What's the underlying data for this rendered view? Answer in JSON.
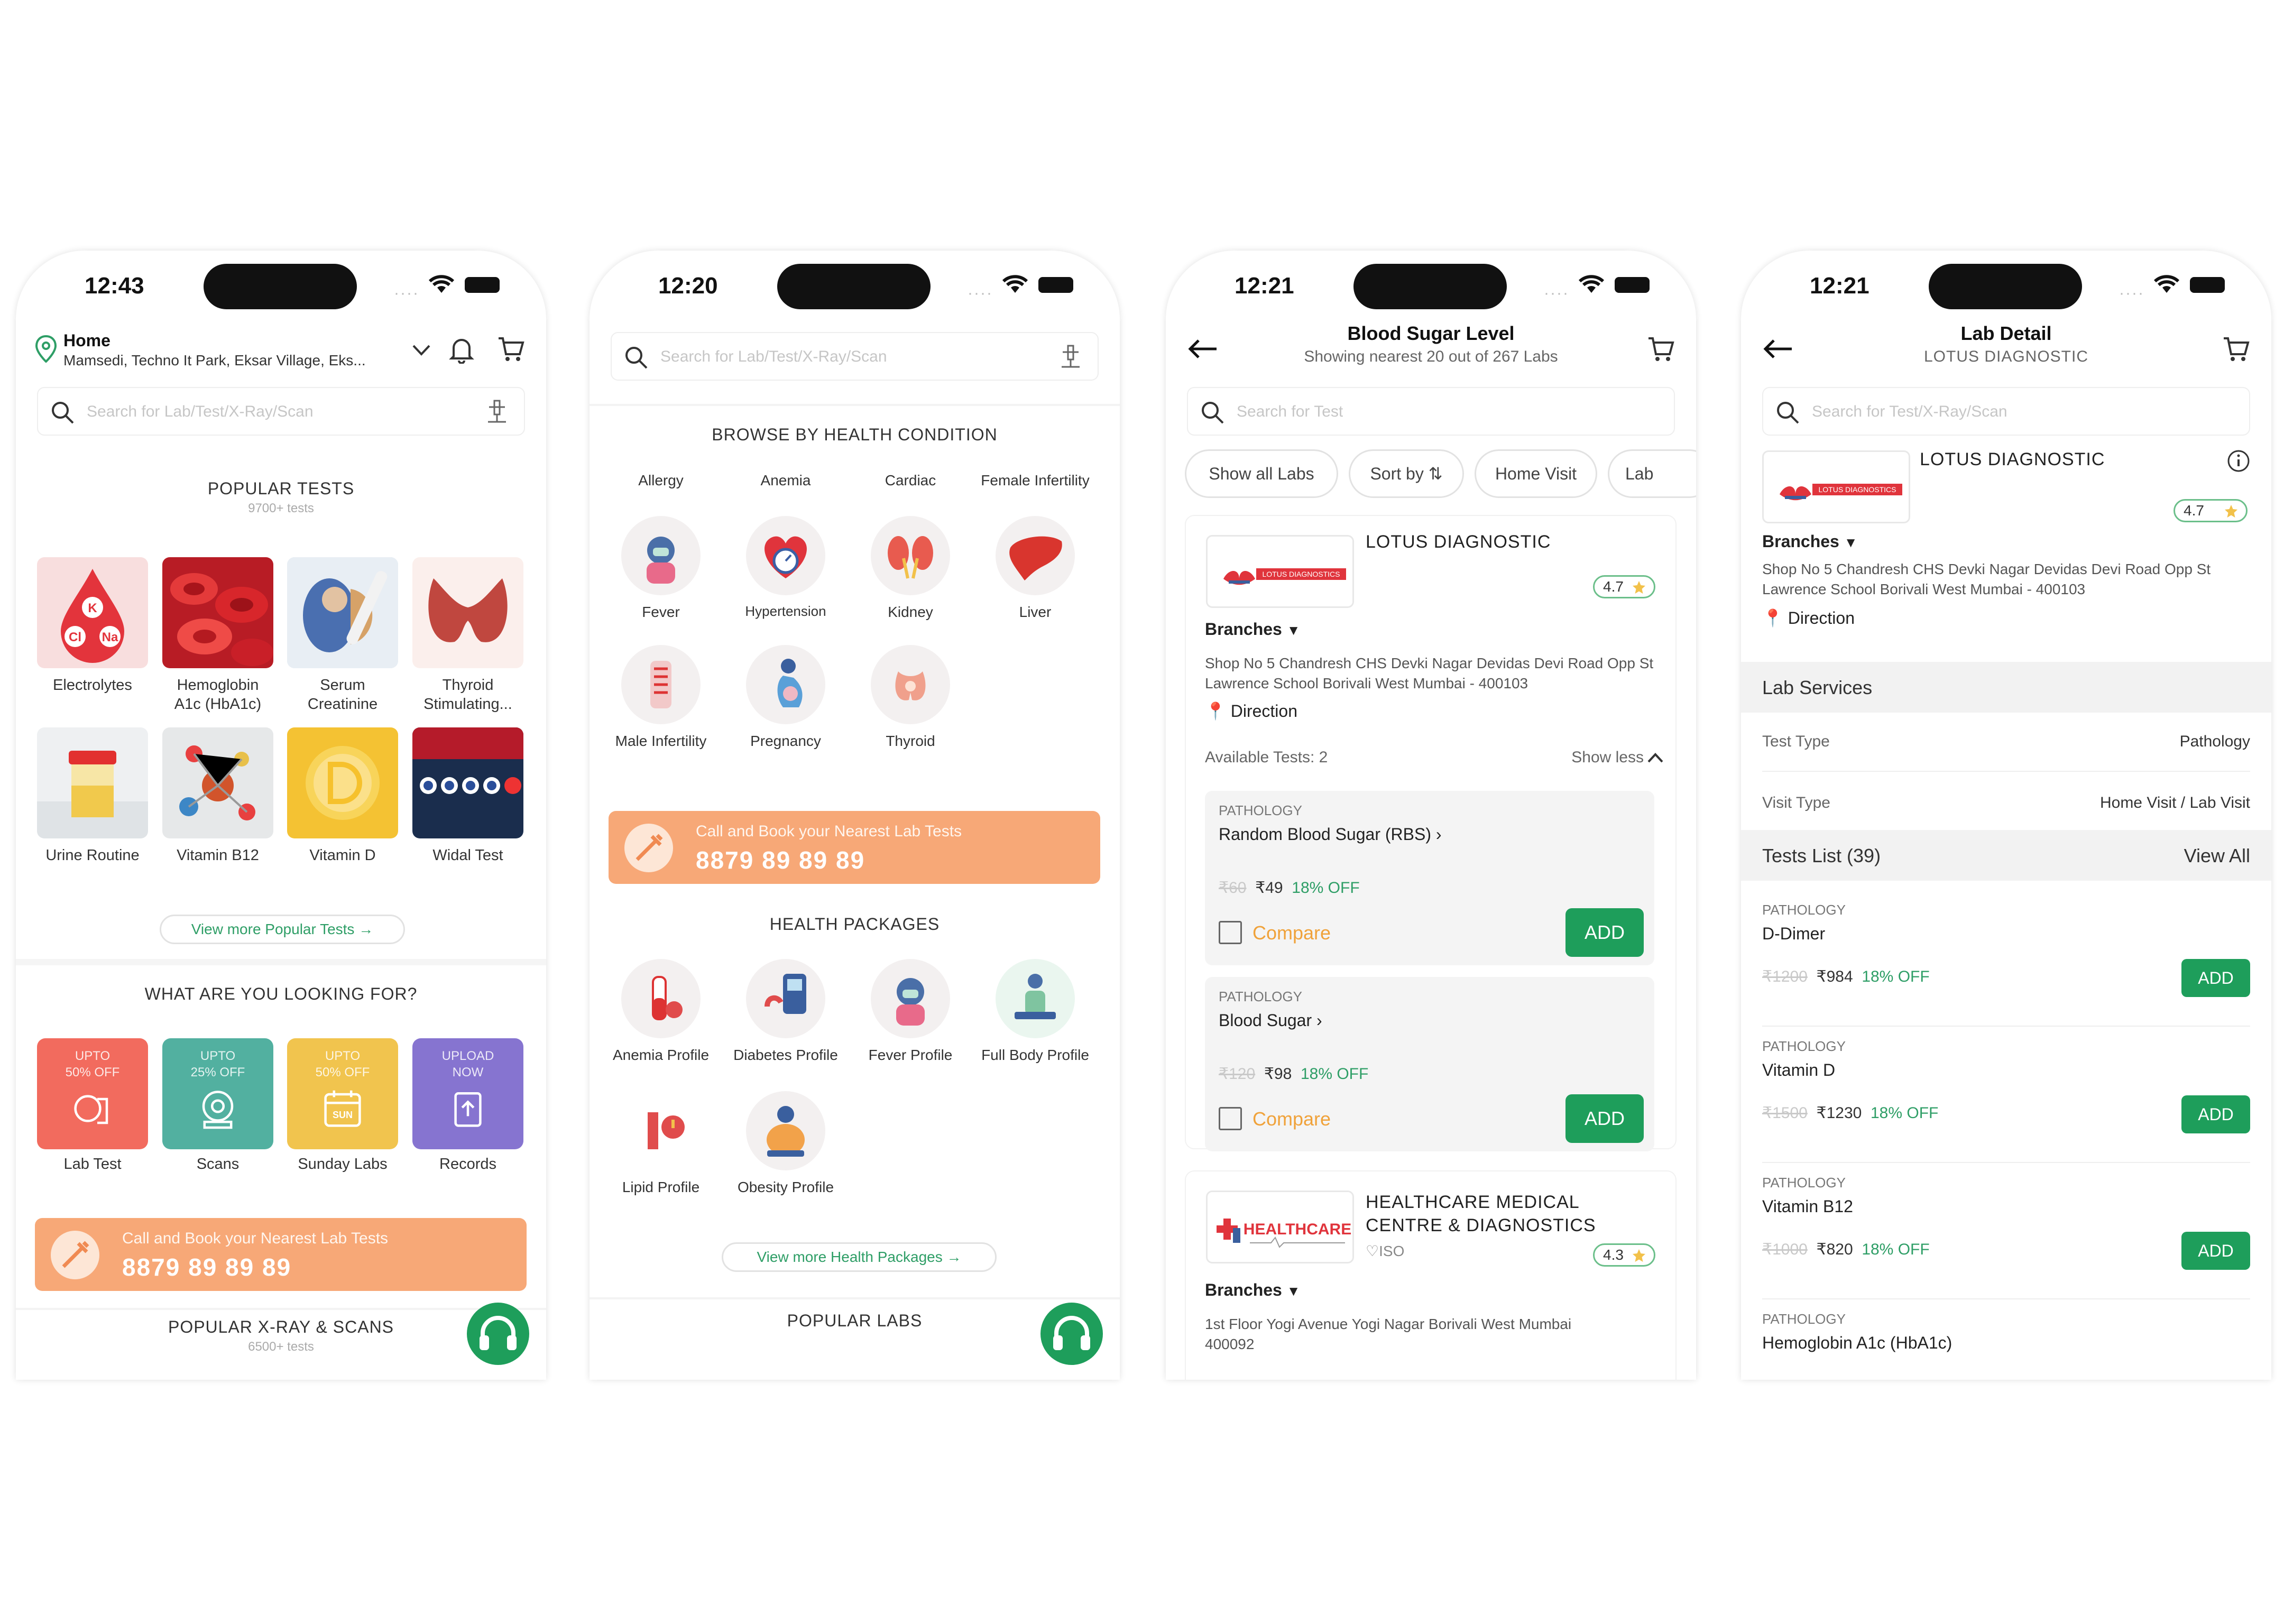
{
  "phone1": {
    "time": "12:43",
    "location": {
      "title": "Home",
      "address": "Mamsedi, Techno It Park, Eksar Village, Eks..."
    },
    "search_placeholder": "Search for Lab/Test/X-Ray/Scan",
    "popular_tests": {
      "title": "POPULAR TESTS",
      "subtitle": "9700+ tests",
      "items": [
        {
          "label": "Electrolytes"
        },
        {
          "label": "Hemoglobin A1c (HbA1c)"
        },
        {
          "label": "Serum Creatinine"
        },
        {
          "label": "Thyroid Stimulating..."
        },
        {
          "label": "Urine Routine"
        },
        {
          "label": "Vitamin B12"
        },
        {
          "label": "Vitamin D"
        },
        {
          "label": "Widal Test"
        }
      ],
      "electrolyte_badges": [
        "K",
        "Cl",
        "Na"
      ],
      "view_more": "View more Popular Tests →"
    },
    "looking_for": {
      "title": "WHAT ARE YOU LOOKING FOR?",
      "items": [
        {
          "promo_line1": "UPTO",
          "promo_line2": "50% OFF",
          "label": "Lab Test",
          "color": "#f26b5e"
        },
        {
          "promo_line1": "UPTO",
          "promo_line2": "25% OFF",
          "label": "Scans",
          "color": "#52b0a0"
        },
        {
          "promo_line1": "UPTO",
          "promo_line2": "50% OFF",
          "label": "Sunday Labs",
          "color": "#f1c44e"
        },
        {
          "promo_line1": "UPLOAD",
          "promo_line2": "NOW",
          "label": "Records",
          "color": "#8674d0"
        }
      ],
      "sunday_icon_text": "SUN"
    },
    "banner": {
      "line1": "Call and Book your Nearest Lab Tests",
      "phone": "8879 89 89 89"
    },
    "xray": {
      "title": "POPULAR X-RAY & SCANS",
      "subtitle": "6500+ tests"
    }
  },
  "phone2": {
    "time": "12:20",
    "search_placeholder": "Search for Lab/Test/X-Ray/Scan",
    "health_condition": {
      "title": "BROWSE BY HEALTH CONDITION",
      "top_row": [
        "Allergy",
        "Anemia",
        "Cardiac",
        "Female Infertility"
      ],
      "items": [
        {
          "label": "Fever"
        },
        {
          "label": "Hypertension"
        },
        {
          "label": "Kidney"
        },
        {
          "label": "Liver"
        },
        {
          "label": "Male Infertility"
        },
        {
          "label": "Pregnancy"
        },
        {
          "label": "Thyroid"
        }
      ]
    },
    "banner": {
      "line1": "Call and Book your Nearest Lab Tests",
      "phone": "8879 89 89 89"
    },
    "health_packages": {
      "title": "HEALTH PACKAGES",
      "items": [
        {
          "label": "Anemia Profile"
        },
        {
          "label": "Diabetes Profile"
        },
        {
          "label": "Fever Profile"
        },
        {
          "label": "Full Body Profile"
        },
        {
          "label": "Lipid Profile"
        },
        {
          "label": "Obesity Profile"
        }
      ],
      "view_more": "View more Health Packages →"
    },
    "popular_labs": "POPULAR LABS"
  },
  "phone3": {
    "time": "12:21",
    "title": "Blood Sugar Level",
    "subtitle": "Showing nearest 20 out of 267 Labs",
    "search_placeholder": "Search for Test",
    "chips": [
      "Show all Labs",
      "Sort by ⇅",
      "Home Visit",
      "Lab"
    ],
    "lab1": {
      "name": "LOTUS DIAGNOSTIC",
      "logo_text": "LOTUS DIAGNOSTICS",
      "rating": "4.7",
      "branches": "Branches",
      "address": "Shop No 5 Chandresh CHS Devki Nagar Devidas Devi Road Opp St Lawrence School Borivali West Mumbai - 400103",
      "direction": "Direction",
      "available": "Available Tests: 2",
      "show_less": "Show less",
      "tests": [
        {
          "category": "PATHOLOGY",
          "name": "Random Blood Sugar (RBS) ›",
          "mrp": "₹60",
          "price": "₹49",
          "off": "18% OFF",
          "compare": "Compare",
          "add": "ADD"
        },
        {
          "category": "PATHOLOGY",
          "name": "Blood Sugar ›",
          "mrp": "₹120",
          "price": "₹98",
          "off": "18% OFF",
          "compare": "Compare",
          "add": "ADD"
        }
      ]
    },
    "lab2": {
      "name_line1": "HEALTHCARE MEDICAL",
      "name_line2": "CENTRE & DIAGNOSTICS",
      "logo_text": "HEALTHCARE",
      "iso": "ISO",
      "rating": "4.3",
      "branches": "Branches",
      "address": "1st Floor Yogi Avenue Yogi Nagar Borivali West Mumbai 400092"
    }
  },
  "phone4": {
    "time": "12:21",
    "title": "Lab Detail",
    "subtitle": "LOTUS DIAGNOSTIC",
    "search_placeholder": "Search for Test/X-Ray/Scan",
    "lab": {
      "name": "LOTUS DIAGNOSTIC",
      "logo_text": "LOTUS DIAGNOSTICS",
      "rating": "4.7",
      "branches": "Branches",
      "address": "Shop No 5 Chandresh CHS Devki Nagar Devidas Devi Road Opp St Lawrence School Borivali West Mumbai - 400103",
      "direction": "Direction"
    },
    "services": {
      "title": "Lab Services",
      "rows": [
        {
          "key": "Test Type",
          "value": "Pathology"
        },
        {
          "key": "Visit Type",
          "value": "Home Visit / Lab Visit"
        }
      ]
    },
    "tests_list": {
      "title": "Tests List (39)",
      "view_all": "View All",
      "items": [
        {
          "category": "PATHOLOGY",
          "name": "D-Dimer",
          "mrp": "₹1200",
          "price": "₹984",
          "off": "18% OFF",
          "add": "ADD"
        },
        {
          "category": "PATHOLOGY",
          "name": "Vitamin D",
          "mrp": "₹1500",
          "price": "₹1230",
          "off": "18% OFF",
          "add": "ADD"
        },
        {
          "category": "PATHOLOGY",
          "name": "Vitamin B12",
          "mrp": "₹1000",
          "price": "₹820",
          "off": "18% OFF",
          "add": "ADD"
        },
        {
          "category": "PATHOLOGY",
          "name": "Hemoglobin A1c (HbA1c)"
        }
      ]
    }
  },
  "colors": {
    "primary_green": "#1e9e5b",
    "banner_orange": "#f7a877",
    "compare_orange": "#f0a23a"
  }
}
